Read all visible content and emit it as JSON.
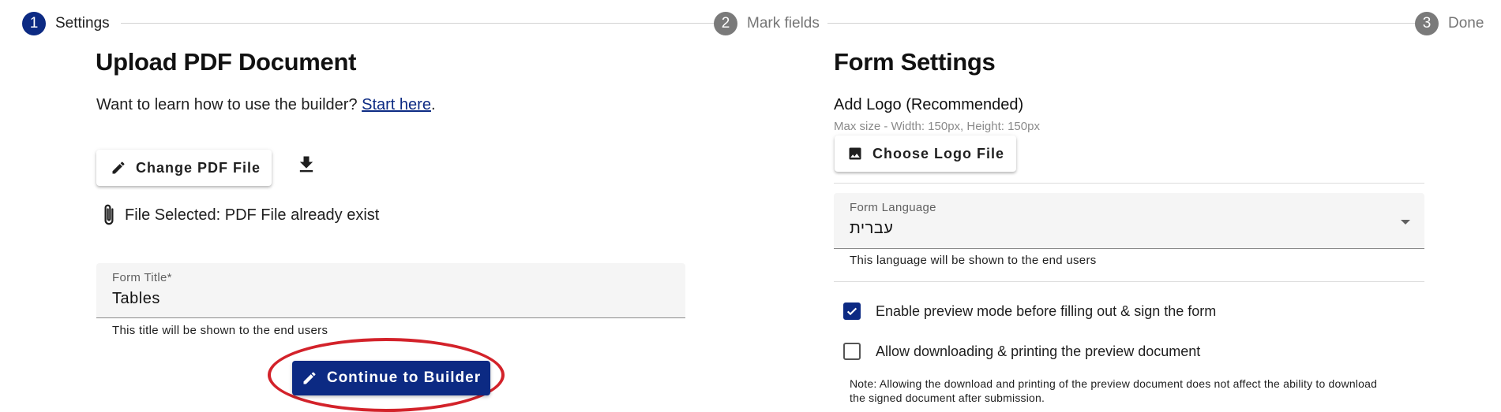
{
  "stepper": {
    "steps": [
      {
        "number": "1",
        "label": "Settings",
        "state": "active"
      },
      {
        "number": "2",
        "label": "Mark fields",
        "state": "inactive"
      },
      {
        "number": "3",
        "label": "Done",
        "state": "inactive"
      }
    ]
  },
  "upload": {
    "title": "Upload PDF Document",
    "learn_text": "Want to learn how to use the builder? ",
    "learn_link": "Start here",
    "learn_suffix": ".",
    "change_button_label": "Change PDF File",
    "file_selected_text": "File Selected: PDF File already exist",
    "form_title_label": "Form Title*",
    "form_title_value": "Tables",
    "form_title_helper": "This title will be shown to the end users",
    "continue_button_label": "Continue to Builder"
  },
  "settings": {
    "title": "Form Settings",
    "add_logo_label": "Add Logo (Recommended)",
    "max_size_text": "Max size - Width: 150px, Height: 150px",
    "choose_logo_button_label": "Choose Logo File",
    "language_label": "Form Language",
    "language_value": "עברית",
    "language_helper": "This language will be shown to the end users",
    "preview_mode_label": "Enable preview mode before filling out & sign the form",
    "preview_mode_checked": true,
    "allow_download_label": "Allow downloading & printing the preview document",
    "allow_download_checked": false,
    "note_text": "Note: Allowing the download and printing of the preview document does not affect the ability to download the signed document after submission."
  },
  "colors": {
    "primary": "#0c2a83",
    "highlight": "#d3222a",
    "inactive_step": "#7a7a7a"
  },
  "icons": [
    "pencil-icon",
    "download-icon",
    "paperclip-icon",
    "image-icon",
    "dropdown-arrow-icon",
    "checkmark-icon"
  ]
}
